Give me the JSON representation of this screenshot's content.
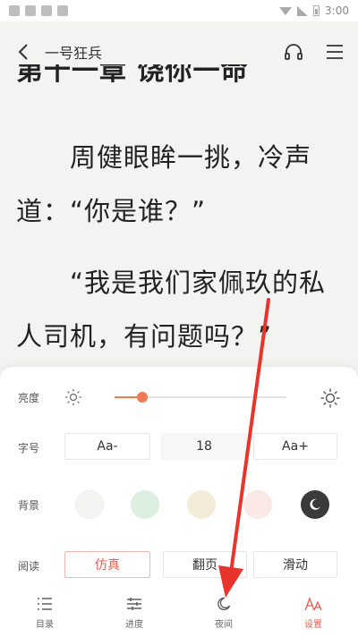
{
  "status_bar": {
    "time": "3:00"
  },
  "header": {
    "title": "一号狂兵"
  },
  "reader": {
    "chapter_title": "第十一章 饶你一命",
    "paragraphs": [
      "　　周健眼眸一挑，冷声道：“你是谁？”",
      "　　“我是我们家佩玖的私人司机，有问题吗？”"
    ]
  },
  "settings": {
    "brightness": {
      "label": "亮度",
      "level": 0.16
    },
    "font_size": {
      "label": "字号",
      "decrease": "Aa-",
      "value": "18",
      "increase": "Aa+"
    },
    "background": {
      "label": "背景",
      "swatches": [
        "#f4f4f2",
        "#dcefe1",
        "#f4ecd8",
        "#fbe9e7",
        "#3a3a3a"
      ]
    },
    "reading": {
      "label": "阅读",
      "modes": [
        "仿真",
        "翻页",
        "滑动"
      ],
      "selected": 0
    }
  },
  "bottom_nav": {
    "items": [
      {
        "label": "目录",
        "icon": "list-icon"
      },
      {
        "label": "进度",
        "icon": "sliders-icon"
      },
      {
        "label": "夜间",
        "icon": "moon-icon"
      },
      {
        "label": "设置",
        "icon": "font-icon"
      }
    ],
    "active": 3
  },
  "colors": {
    "accent": "#e85a4f",
    "slider": "#f07a55",
    "arrow": "#e8342a"
  }
}
